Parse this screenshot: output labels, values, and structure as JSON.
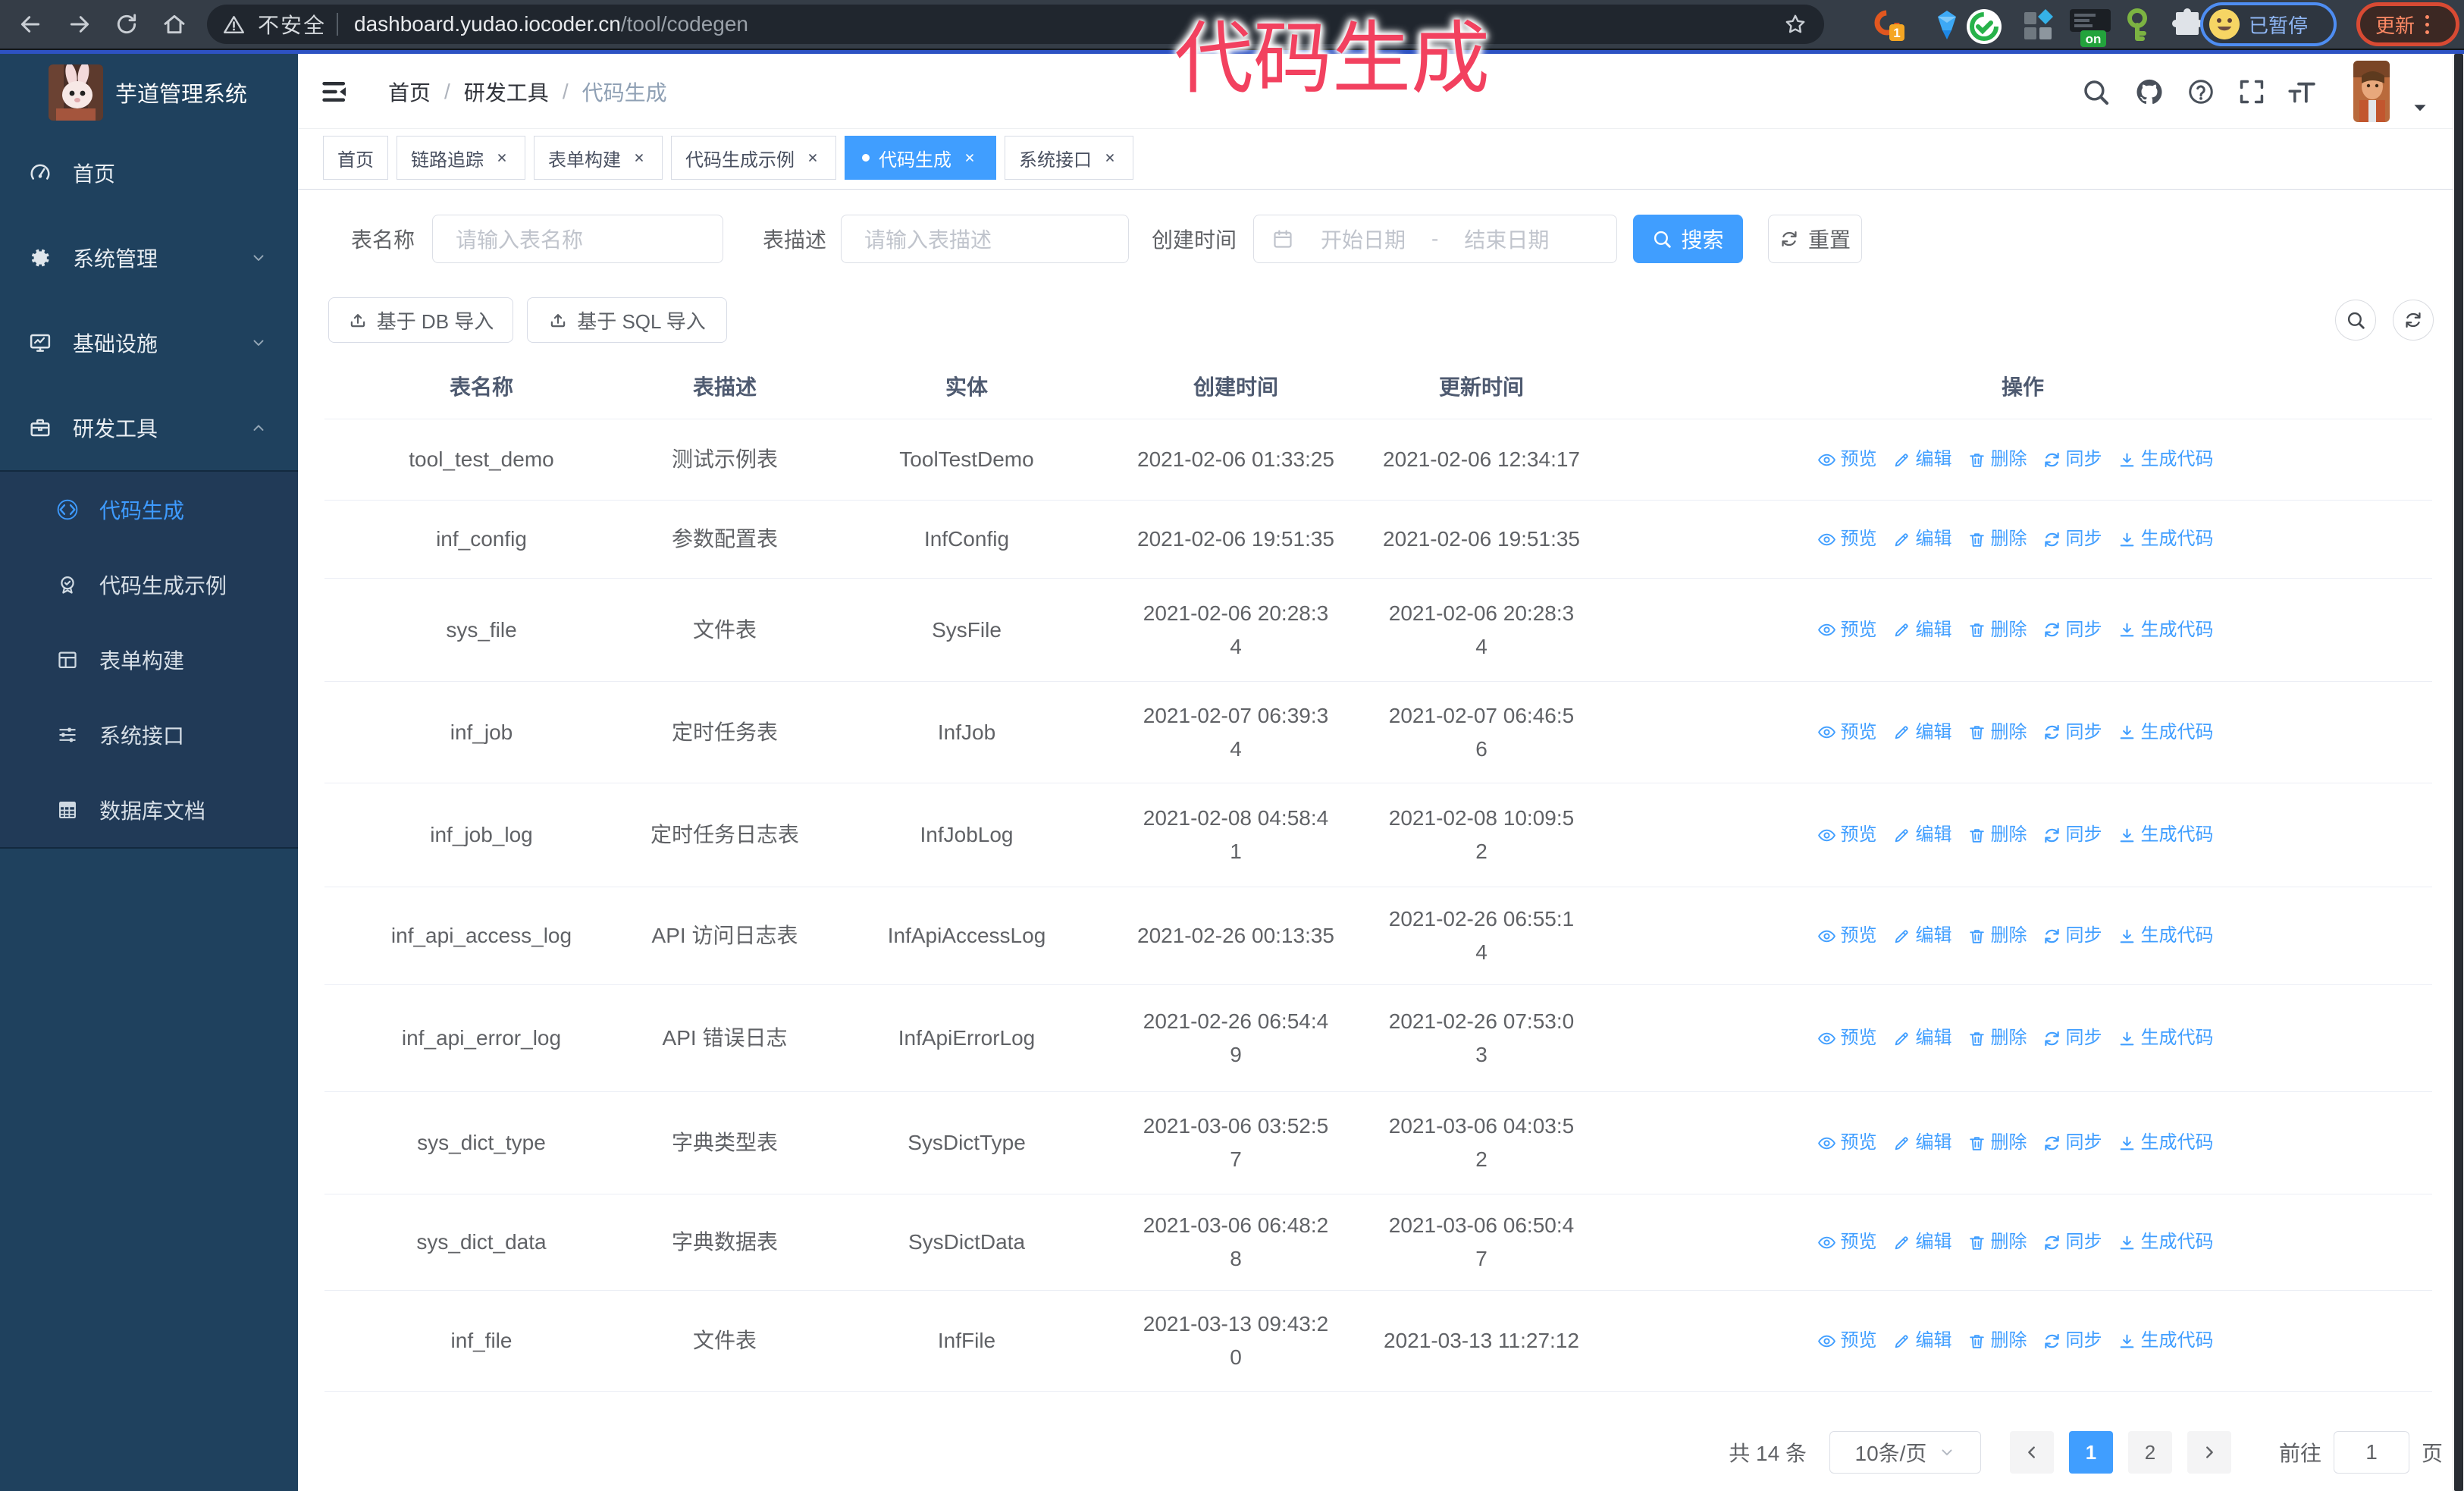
{
  "browser": {
    "security_label": "不安全",
    "url_host": "dashboard.yudao.iocoder.cn",
    "url_path": "/tool/codegen",
    "profile_label": "已暂停",
    "update_label": "更新",
    "ext_badge": "1",
    "ext_on_badge": "on"
  },
  "annotation": {
    "title": "代码生成"
  },
  "sidebar": {
    "logo_title": "芋道管理系统",
    "menu": [
      {
        "label": "首页"
      },
      {
        "label": "系统管理"
      },
      {
        "label": "基础设施"
      },
      {
        "label": "研发工具"
      }
    ],
    "submenu": [
      {
        "label": "代码生成"
      },
      {
        "label": "代码生成示例"
      },
      {
        "label": "表单构建"
      },
      {
        "label": "系统接口"
      },
      {
        "label": "数据库文档"
      }
    ]
  },
  "navbar": {
    "breadcrumb": [
      "首页",
      "研发工具",
      "代码生成"
    ]
  },
  "tags": [
    {
      "label": "首页"
    },
    {
      "label": "链路追踪"
    },
    {
      "label": "表单构建"
    },
    {
      "label": "代码生成示例"
    },
    {
      "label": "代码生成"
    },
    {
      "label": "系统接口"
    }
  ],
  "filters": {
    "name_label": "表名称",
    "name_placeholder": "请输入表名称",
    "desc_label": "表描述",
    "desc_placeholder": "请输入表描述",
    "time_label": "创建时间",
    "start_placeholder": "开始日期",
    "range_separator": "-",
    "end_placeholder": "结束日期",
    "search_label": "搜索",
    "reset_label": "重置"
  },
  "toolbar": {
    "import_db_label": "基于 DB 导入",
    "import_sql_label": "基于 SQL 导入"
  },
  "table": {
    "headers": [
      "表名称",
      "表描述",
      "实体",
      "创建时间",
      "更新时间",
      "操作"
    ],
    "actions": [
      "预览",
      "编辑",
      "删除",
      "同步",
      "生成代码"
    ],
    "rows": [
      {
        "name": "tool_test_demo",
        "desc": "测试示例表",
        "entity": "ToolTestDemo",
        "create_time": "2021-02-06 01:33:25",
        "create_wrap": false,
        "update_time": "2021-02-06 12:34:17",
        "update_wrap": false
      },
      {
        "name": "inf_config",
        "desc": "参数配置表",
        "entity": "InfConfig",
        "create_time": "2021-02-06 19:51:35",
        "create_wrap": false,
        "update_time": "2021-02-06 19:51:35",
        "update_wrap": false
      },
      {
        "name": "sys_file",
        "desc": "文件表",
        "entity": "SysFile",
        "create_time": "2021-02-06 20:28:34",
        "create_wrap": true,
        "update_time": "2021-02-06 20:28:34",
        "update_wrap": true
      },
      {
        "name": "inf_job",
        "desc": "定时任务表",
        "entity": "InfJob",
        "create_time": "2021-02-07 06:39:34",
        "create_wrap": true,
        "update_time": "2021-02-07 06:46:56",
        "update_wrap": true
      },
      {
        "name": "inf_job_log",
        "desc": "定时任务日志表",
        "entity": "InfJobLog",
        "create_time": "2021-02-08 04:58:41",
        "create_wrap": true,
        "update_time": "2021-02-08 10:09:52",
        "update_wrap": true
      },
      {
        "name": "inf_api_access_log",
        "desc": "API 访问日志表",
        "entity": "InfApiAccessLog",
        "create_time": "2021-02-26 00:13:35",
        "create_wrap": false,
        "update_time": "2021-02-26 06:55:14",
        "update_wrap": true
      },
      {
        "name": "inf_api_error_log",
        "desc": "API 错误日志",
        "entity": "InfApiErrorLog",
        "create_time": "2021-02-26 06:54:49",
        "create_wrap": true,
        "update_time": "2021-02-26 07:53:03",
        "update_wrap": true
      },
      {
        "name": "sys_dict_type",
        "desc": "字典类型表",
        "entity": "SysDictType",
        "create_time": "2021-03-06 03:52:57",
        "create_wrap": true,
        "update_time": "2021-03-06 04:03:52",
        "update_wrap": true
      },
      {
        "name": "sys_dict_data",
        "desc": "字典数据表",
        "entity": "SysDictData",
        "create_time": "2021-03-06 06:48:28",
        "create_wrap": true,
        "update_time": "2021-03-06 06:50:47",
        "update_wrap": true
      },
      {
        "name": "inf_file",
        "desc": "文件表",
        "entity": "InfFile",
        "create_time": "2021-03-13 09:43:20",
        "create_wrap": true,
        "update_time": "2021-03-13 11:27:12",
        "update_wrap": false
      }
    ]
  },
  "pagination": {
    "total_label": "共 14 条",
    "page_size": "10条/页",
    "pages": [
      "1",
      "2"
    ],
    "active_page": "1",
    "jump_label": "前往",
    "jump_value": "1",
    "page_unit": "页"
  },
  "colors": {
    "accent": "#409eff",
    "annotation": "#f2415f",
    "sidebar": "#21405d"
  }
}
